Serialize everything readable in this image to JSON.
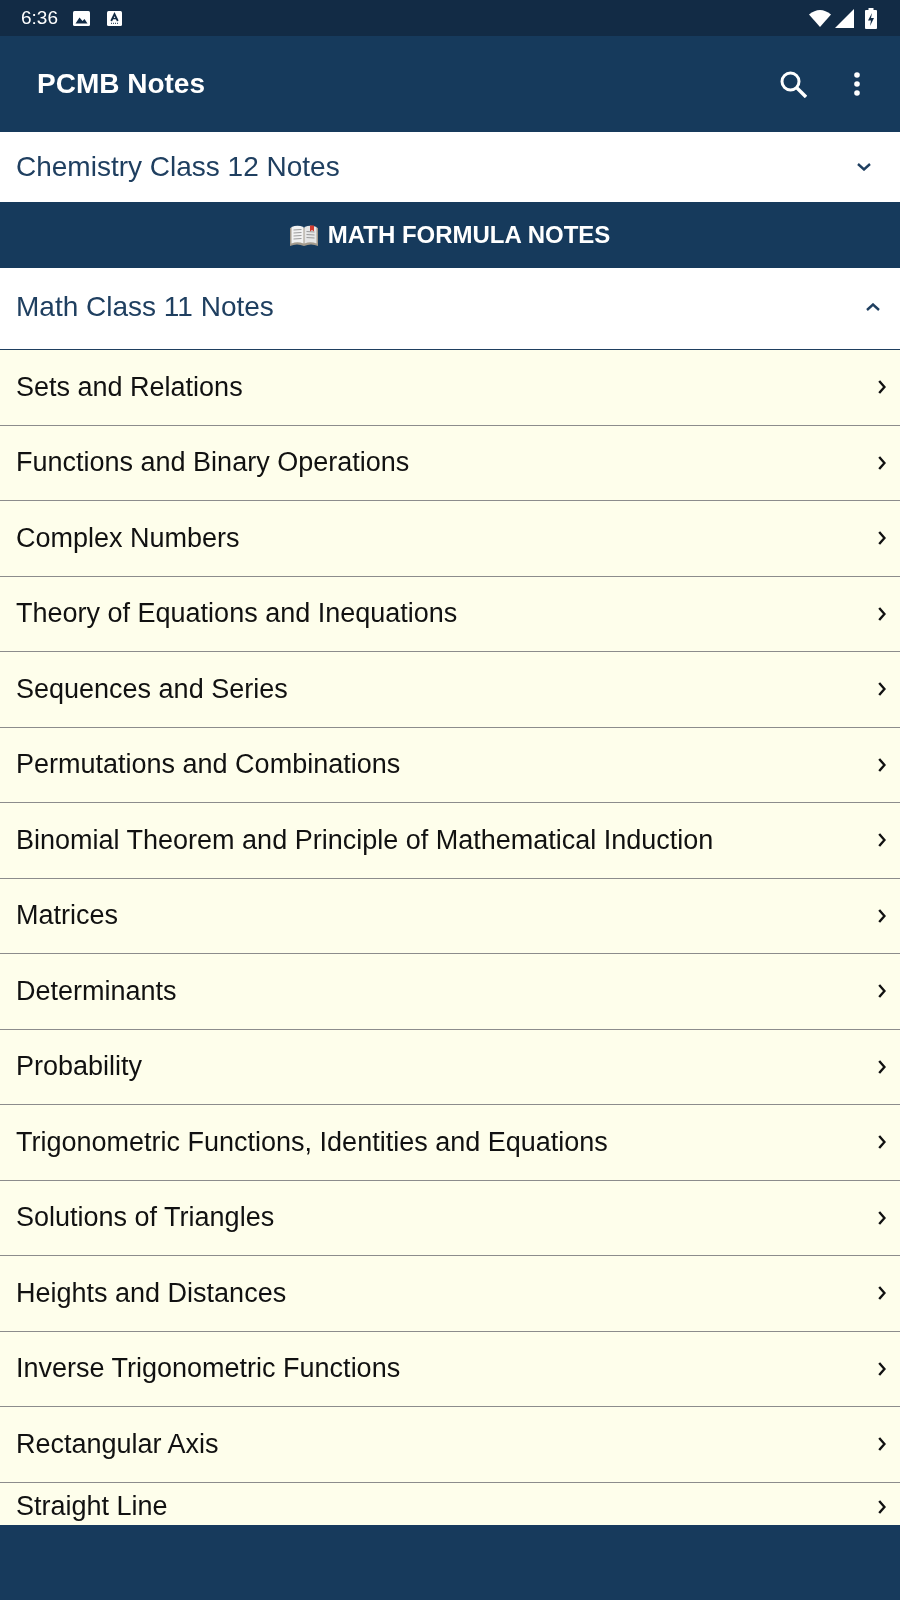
{
  "status_bar": {
    "time": "6:36"
  },
  "app_bar": {
    "title": "PCMB Notes"
  },
  "sections": [
    {
      "kind": "accordion",
      "title": "Chemistry Class 12 Notes",
      "expanded": false
    },
    {
      "kind": "banner",
      "title": "MATH FORMULA NOTES"
    },
    {
      "kind": "accordion",
      "title": "Math Class 11 Notes",
      "expanded": true,
      "items": [
        "Sets and Relations",
        "Functions and Binary Operations",
        "Complex Numbers",
        "Theory of Equations and Inequations",
        "Sequences and Series",
        "Permutations and Combinations",
        "Binomial Theorem and Principle of Mathematical Induction",
        "Matrices",
        "Determinants",
        "Probability",
        "Trigonometric Functions, Identities and Equations",
        "Solutions of Triangles",
        "Heights and Distances",
        "Inverse Trigonometric Functions",
        "Rectangular Axis",
        "Straight Line"
      ]
    }
  ]
}
